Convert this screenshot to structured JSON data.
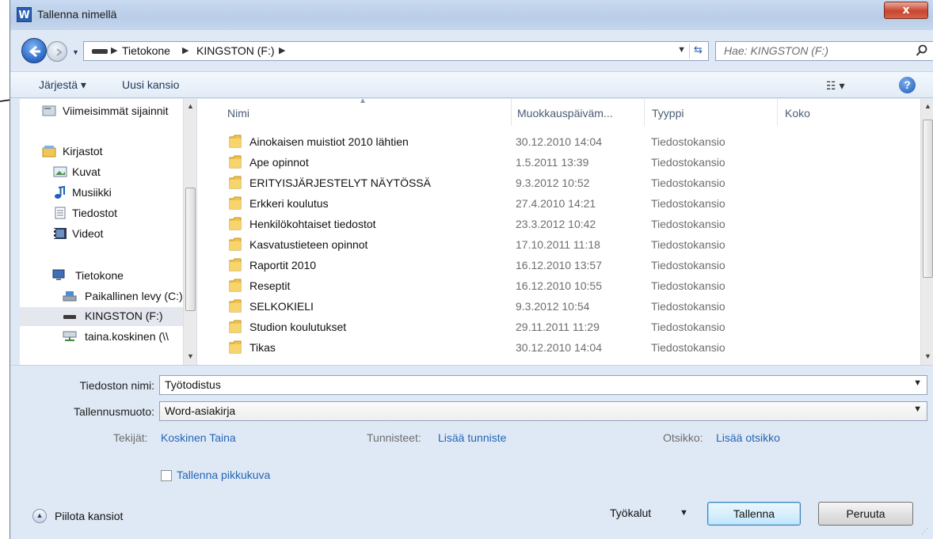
{
  "window": {
    "app_icon_letter": "W",
    "title": "Tallenna nimellä",
    "close_symbol": "x"
  },
  "nav": {
    "breadcrumbs": [
      "Tietokone",
      "KINGSTON (F:)"
    ],
    "search_placeholder": "Hae: KINGSTON (F:)"
  },
  "toolbar": {
    "organize_label": "Järjestä ▾",
    "new_folder_label": "Uusi kansio",
    "help_label": "?"
  },
  "sidebar": {
    "items": [
      {
        "label": "Viimeisimmät sijainnit",
        "icon": "recent-places-icon"
      },
      {
        "label": "Kirjastot",
        "icon": "libraries-icon"
      },
      {
        "label": "Kuvat",
        "icon": "pictures-icon"
      },
      {
        "label": "Musiikki",
        "icon": "music-icon"
      },
      {
        "label": "Tiedostot",
        "icon": "documents-icon"
      },
      {
        "label": "Videot",
        "icon": "videos-icon"
      },
      {
        "label": "Tietokone",
        "icon": "computer-icon"
      },
      {
        "label": "Paikallinen levy (C:)",
        "icon": "local-disk-icon"
      },
      {
        "label": "KINGSTON (F:)",
        "icon": "usb-drive-icon",
        "selected": true
      },
      {
        "label": "taina.koskinen (\\\\",
        "icon": "network-drive-icon"
      }
    ]
  },
  "files": {
    "columns": [
      "Nimi",
      "Muokkauspäivämäärä",
      "Tyyppi",
      "Koko"
    ],
    "columns_display": [
      "Nimi",
      "Muokkauspäiväm...",
      "Tyyppi",
      "Koko"
    ],
    "rows": [
      {
        "name": "Ainokaisen muistiot 2010 lähtien",
        "date": "30.12.2010 14:04",
        "type": "Tiedostokansio"
      },
      {
        "name": "Ape opinnot",
        "date": "1.5.2011 13:39",
        "type": "Tiedostokansio"
      },
      {
        "name": "ERITYISJÄRJESTELYT NÄYTÖSSÄ",
        "date": "9.3.2012 10:52",
        "type": "Tiedostokansio"
      },
      {
        "name": "Erkkeri koulutus",
        "date": "27.4.2010 14:21",
        "type": "Tiedostokansio"
      },
      {
        "name": "Henkilökohtaiset tiedostot",
        "date": "23.3.2012 10:42",
        "type": "Tiedostokansio"
      },
      {
        "name": "Kasvatustieteen opinnot",
        "date": "17.10.2011 11:18",
        "type": "Tiedostokansio"
      },
      {
        "name": "Raportit 2010",
        "date": "16.12.2010 13:57",
        "type": "Tiedostokansio"
      },
      {
        "name": "Reseptit",
        "date": "16.12.2010 10:55",
        "type": "Tiedostokansio"
      },
      {
        "name": "SELKOKIELI",
        "date": "9.3.2012 10:54",
        "type": "Tiedostokansio"
      },
      {
        "name": "Studion koulutukset",
        "date": "29.11.2011 11:29",
        "type": "Tiedostokansio"
      },
      {
        "name": "Tikas",
        "date": "30.12.2010 14:04",
        "type": "Tiedostokansio"
      }
    ]
  },
  "form": {
    "filename_label": "Tiedoston nimi:",
    "filename_value": "Työtodistus",
    "format_label": "Tallennusmuoto:",
    "format_value": "Word-asiakirja",
    "authors_label": "Tekijät:",
    "authors_value": "Koskinen Taina",
    "tags_label": "Tunnisteet:",
    "tags_value": "Lisää tunniste",
    "title_label": "Otsikko:",
    "title_value": "Lisää otsikko",
    "thumbnail_label": "Tallenna pikkukuva"
  },
  "footer": {
    "hide_folders_label": "Piilota kansiot",
    "tools_label": "Työkalut",
    "save_label": "Tallenna",
    "cancel_label": "Peruuta"
  },
  "colors": {
    "frame": "#dfe9f5",
    "link": "#2565b4",
    "folder": "#f0c24a"
  }
}
